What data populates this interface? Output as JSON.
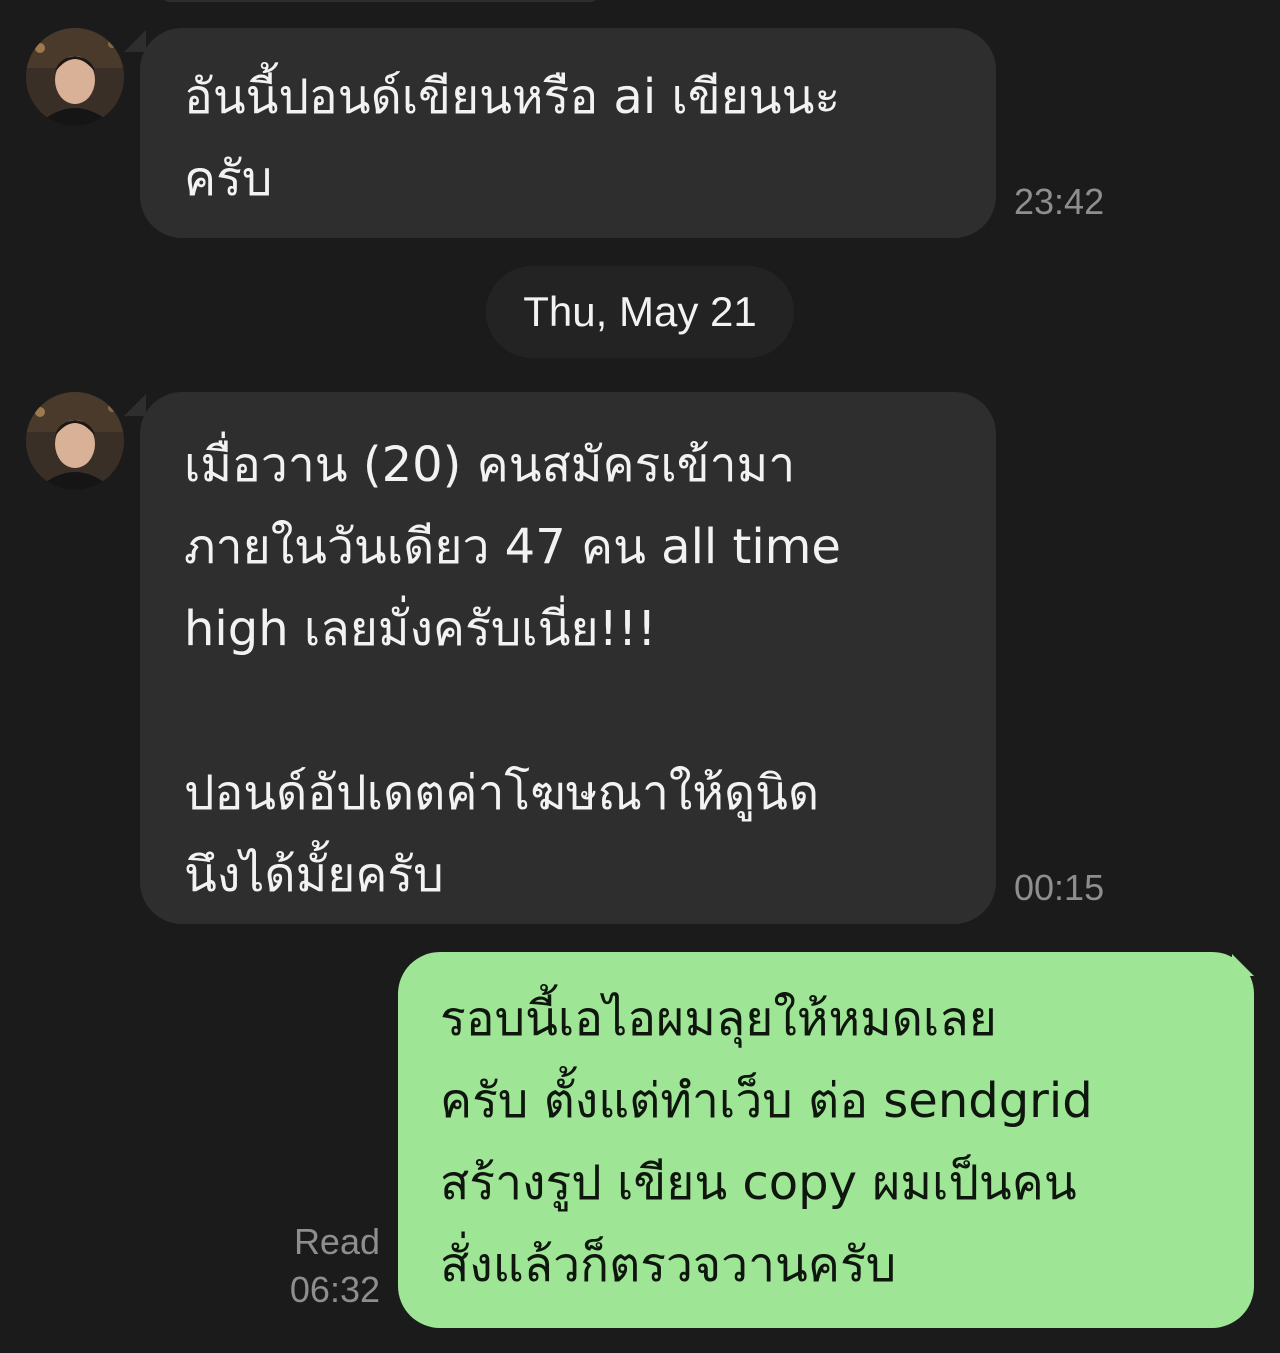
{
  "contact": {
    "avatar_icon": "user-avatar-photo"
  },
  "messages": [
    {
      "direction": "incoming",
      "text": "อันนี้ปอนด์เขียนหรือ ai เขียนนะ\nครับ",
      "time": "23:42"
    },
    {
      "direction": "incoming",
      "text": "เมื่อวาน (20) คนสมัครเข้ามา\nภายในวันเดียว 47 คน all time\nhigh เลยมั่งครับเนี่ย!!!\n\nปอนด์อัปเดตค่าโฆษณาให้ดูนิด\nนึงได้มั้ยครับ",
      "time": "00:15"
    },
    {
      "direction": "outgoing",
      "text": "รอบนี้เอไอผมลุยให้หมดเลย\nครับ ตั้งแต่ทำเว็บ ต่อ sendgrid\nสร้างรูป เขียน copy ผมเป็นคน\nสั่งแล้วก็ตรวจวานครับ",
      "read_label": "Read",
      "time": "06:32"
    }
  ],
  "date_separator": "Thu, May 21",
  "colors": {
    "background": "#1b1b1b",
    "incoming_bubble": "#2e2e2e",
    "outgoing_bubble": "#9fe596",
    "timestamp": "#8e8e8e"
  }
}
